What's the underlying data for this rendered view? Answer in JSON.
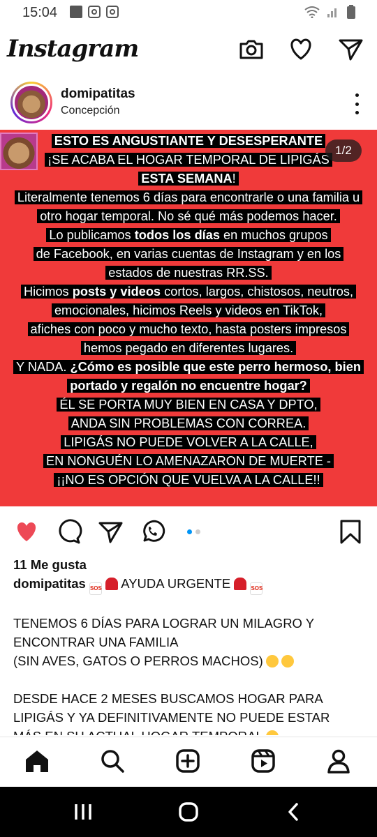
{
  "status_bar": {
    "time": "15:04",
    "left_icons": [
      "gallery-icon",
      "instagram-icon",
      "instagram-icon"
    ],
    "right_icons": [
      "wifi-icon",
      "signal-icon",
      "battery-icon"
    ]
  },
  "header": {
    "logo": "Instagram",
    "icons": [
      "camera-icon",
      "heart-icon",
      "send-icon"
    ]
  },
  "post": {
    "username": "domipatitas",
    "location": "Concepción",
    "image_counter": "1/2",
    "image_bg_color": "#f03a3a",
    "image_lines": [
      {
        "parts": [
          {
            "t": "ESTO ES ANGUSTIANTE Y DESESPERANTE",
            "b": true
          }
        ]
      },
      {
        "parts": [
          {
            "t": "¡SE ACABA EL HOGAR TEMPORAL DE LIPIGÁS",
            "b": false
          }
        ]
      },
      {
        "parts": [
          {
            "t": "ESTA SEMANA",
            "b": true
          },
          {
            "t": "!",
            "b": false
          }
        ]
      },
      {
        "parts": [
          {
            "t": "Literalmente tenemos 6 días para encontrarle o una familia u",
            "b": false
          }
        ]
      },
      {
        "parts": [
          {
            "t": "otro hogar temporal. No sé qué más podemos hacer.",
            "b": false
          }
        ]
      },
      {
        "parts": [
          {
            "t": "Lo publicamos ",
            "b": false
          },
          {
            "t": "todos los días",
            "b": true
          },
          {
            "t": " en muchos grupos",
            "b": false
          }
        ]
      },
      {
        "parts": [
          {
            "t": "de Facebook, en varias cuentas de Instagram y en los",
            "b": false
          }
        ]
      },
      {
        "parts": [
          {
            "t": "estados de nuestras RR.SS.",
            "b": false
          }
        ]
      },
      {
        "parts": [
          {
            "t": "Hicimos ",
            "b": false
          },
          {
            "t": "posts y videos",
            "b": true
          },
          {
            "t": " cortos, largos, chistosos, neutros,",
            "b": false
          }
        ]
      },
      {
        "parts": [
          {
            "t": "emocionales, hicimos Reels y videos en TikTok,",
            "b": false
          }
        ]
      },
      {
        "parts": [
          {
            "t": "afiches con poco y mucho texto, hasta posters impresos",
            "b": false
          }
        ]
      },
      {
        "parts": [
          {
            "t": "hemos pegado en diferentes lugares.",
            "b": false
          }
        ]
      },
      {
        "parts": [
          {
            "t": "Y NADA. ",
            "b": false
          },
          {
            "t": "¿Cómo es posible que este perro hermoso, bien",
            "b": true
          }
        ]
      },
      {
        "parts": [
          {
            "t": "portado y regalón no encuentre hogar?",
            "b": true
          }
        ]
      },
      {
        "parts": [
          {
            "t": "ÉL SE PORTA MUY BIEN EN CASA Y DPTO,",
            "b": false
          }
        ]
      },
      {
        "parts": [
          {
            "t": "ANDA SIN PROBLEMAS CON CORREA.",
            "b": false
          }
        ]
      },
      {
        "parts": [
          {
            "t": "LIPIGÁS NO PUEDE VOLVER A LA CALLE,",
            "b": false
          }
        ]
      },
      {
        "parts": [
          {
            "t": "EN NONGUÉN LO AMENAZARON DE MUERTE -",
            "b": false
          }
        ]
      },
      {
        "parts": [
          {
            "t": "¡¡NO ES OPCIÓN QUE VUELVA A LA CALLE!!",
            "b": false
          }
        ]
      }
    ],
    "actions": [
      "like-icon",
      "comment-icon",
      "share-icon",
      "whatsapp-icon",
      "save-icon"
    ],
    "like_color": "#ed4956",
    "carousel": {
      "count": 2,
      "active": 1
    },
    "likes": "11 Me gusta",
    "caption_user": "domipatitas",
    "caption_title": " AYUDA URGENTE ",
    "caption_lines": [
      "TENEMOS 6 DÍAS PARA LOGRAR UN MILAGRO Y",
      "ENCONTRAR UNA FAMILIA",
      "(SIN AVES, GATOS O PERROS MACHOS)",
      "",
      "DESDE HACE 2 MESES BUSCAMOS HOGAR PARA",
      "LIPIGÁS Y YA DEFINITIVAMENTE NO PUEDE ESTAR",
      "MÁS EN SU ACTUAL HOGAR TEMPORAL"
    ]
  },
  "bottom_nav": [
    "home-icon",
    "search-icon",
    "create-icon",
    "reels-icon",
    "profile-icon"
  ],
  "system_nav": [
    "recents-icon",
    "home-circle-icon",
    "back-icon"
  ]
}
